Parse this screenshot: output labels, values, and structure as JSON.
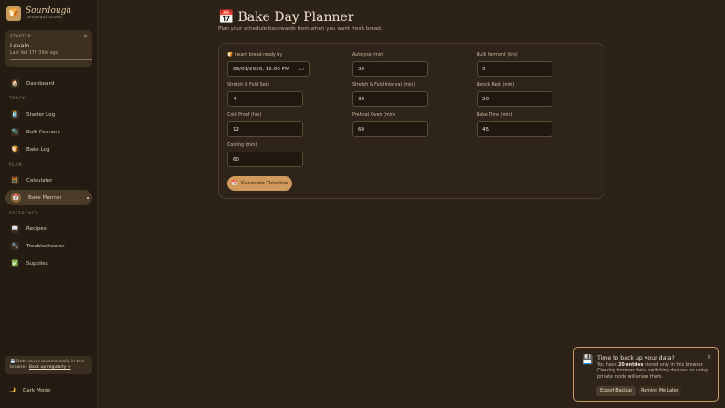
{
  "brand": {
    "name": "Sourdough",
    "subtitle": "contempt8.studio",
    "logo_icon": "bread-icon"
  },
  "starter": {
    "section": "STARTER",
    "name": "Levain",
    "last_fed": "Last fed 17h 39m ago"
  },
  "nav": {
    "dashboard": "Dashboard",
    "track_section": "TRACK",
    "starter_log": "Starter Log",
    "bulk_ferment": "Bulk Ferment",
    "bake_log": "Bake Log",
    "plan_section": "PLAN",
    "calculator": "Calculator",
    "bake_planner": "Bake Planner",
    "reference_section": "REFERENCE",
    "recipes": "Recipes",
    "troubleshooter": "Troubleshooter",
    "supplies": "Supplies"
  },
  "save_note": {
    "text": "💾 Data saves automatically in this browser.",
    "link": "Back up regularly →"
  },
  "dark_mode": "Dark Mode",
  "page": {
    "title": "Bake Day Planner",
    "subtitle": "Plan your schedule backwards from when you want fresh bread."
  },
  "form": {
    "ready_by": {
      "label": "🍞 I want bread ready by",
      "value": "09/01/2026, 12:00 PM"
    },
    "autolyse": {
      "label": "Autolyse (min)",
      "value": "30"
    },
    "bulk_ferment": {
      "label": "Bulk Ferment (hrs)",
      "value": "5"
    },
    "sf_sets": {
      "label": "Stretch & Fold Sets",
      "value": "4"
    },
    "sf_interval": {
      "label": "Stretch & Fold Interval (min)",
      "value": "30"
    },
    "bench_rest": {
      "label": "Bench Rest (min)",
      "value": "20"
    },
    "cold_proof": {
      "label": "Cold Proof (hrs)",
      "value": "12"
    },
    "preheat": {
      "label": "Preheat Oven (min)",
      "value": "60"
    },
    "bake_time": {
      "label": "Bake Time (min)",
      "value": "45"
    },
    "cooling": {
      "label": "Cooling (min)",
      "value": "60"
    },
    "generate_label": "Generate Timeline"
  },
  "toast": {
    "title": "Time to back up your data?",
    "body_prefix": "You have ",
    "count": "20 entries",
    "body_suffix": " stored only in this browser. Clearing browser data, switching devices, or using private mode will erase them.",
    "export_label": "Export Backup",
    "remind_label": "Remind Me Later"
  },
  "colors": {
    "accent": "#d09a5c",
    "background": "#2c2217",
    "sidebar": "#241c13"
  }
}
